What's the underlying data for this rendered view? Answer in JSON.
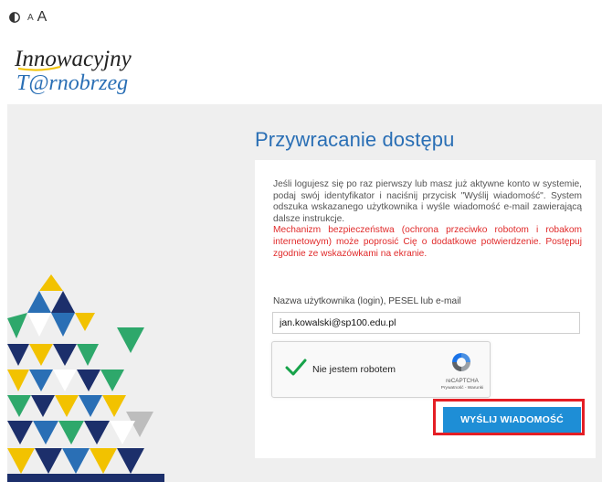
{
  "toolbar": {
    "contrast_icon": "contrast-icon",
    "font_small": "A",
    "font_large": "A"
  },
  "logo": {
    "line1": "Innowacyjny",
    "line2": "T@rnobrzeg"
  },
  "page": {
    "title": "Przywracanie dostępu",
    "description": "Jeśli logujesz się po raz pierwszy lub masz już aktywne konto w systemie, podaj swój identyfikator i naciśnij przycisk \"Wyślij wiadomość\". System odszuka wskazanego użytkownika i wyśle wiadomość e-mail zawierającą dalsze instrukcje.",
    "warning": "Mechanizm bezpieczeństwa (ochrona przeciwko robotom i robakom internetowym) może poprosić Cię o dodatkowe potwierdzenie. Postępuj zgodnie ze wskazówkami na ekranie."
  },
  "form": {
    "login_label": "Nazwa użytkownika (login), PESEL lub e-mail",
    "login_value": "jan.kowalski@sp100.edu.pl",
    "submit_label": "WYŚLIJ WIADOMOŚĆ"
  },
  "captcha": {
    "label": "Nie jestem robotem",
    "brand": "reCAPTCHA",
    "links": "Prywatność - Warunki",
    "checked": true
  },
  "colors": {
    "title": "#2a6fb5",
    "warning": "#e02a2a",
    "button": "#1e8ed6",
    "highlight": "#e41e25",
    "panel": "#efefef"
  }
}
